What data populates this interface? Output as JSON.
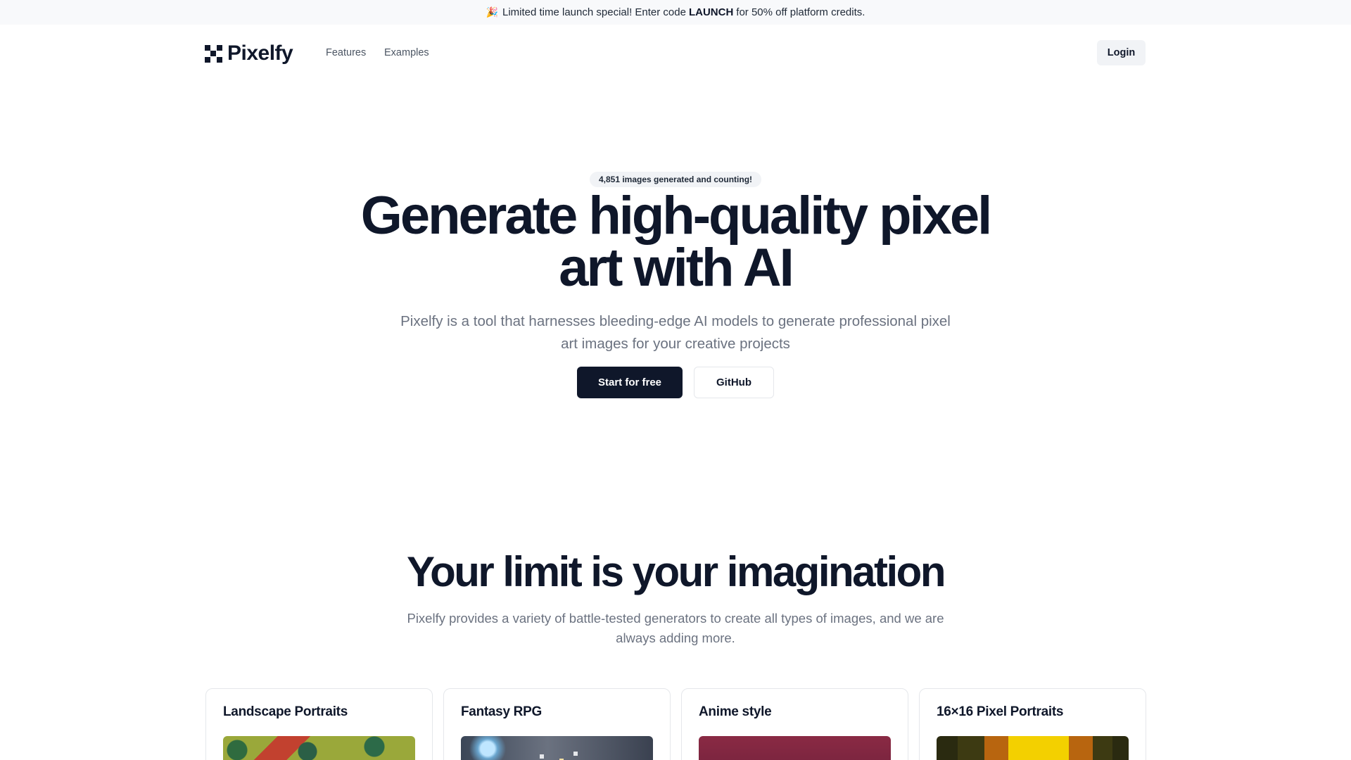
{
  "banner": {
    "emoji": "🎉",
    "text_before": "Limited time launch special! Enter code",
    "code": "LAUNCH",
    "text_after": "for 50% off platform credits."
  },
  "nav": {
    "brand": "Pixelfy",
    "links": [
      "Features",
      "Examples"
    ],
    "login_label": "Login"
  },
  "hero": {
    "badge": "4,851 images generated and counting!",
    "title": "Generate high-quality pixel art with AI",
    "subtitle": "Pixelfy is a tool that harnesses bleeding-edge AI models to generate professional pixel art images for your creative projects",
    "primary_cta": "Start for free",
    "secondary_cta": "GitHub"
  },
  "section": {
    "title": "Your limit is your imagination",
    "subtitle": "Pixelfy provides a variety of battle-tested generators to create all types of images, and we are always adding more."
  },
  "cards": [
    {
      "title": "Landscape Portraits"
    },
    {
      "title": "Fantasy RPG"
    },
    {
      "title": "Anime style"
    },
    {
      "title": "16×16 Pixel Portraits"
    }
  ],
  "colors": {
    "primary": "#0f172a",
    "muted_text": "#6b7280",
    "banner_bg": "#f8f9fb"
  }
}
